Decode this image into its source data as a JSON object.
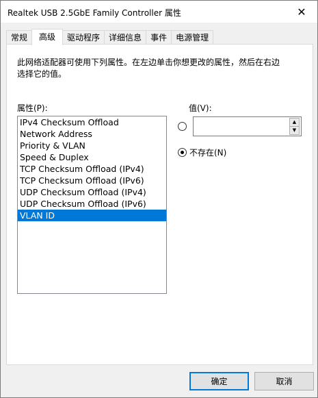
{
  "window": {
    "title": "Realtek USB 2.5GbE Family Controller 属性",
    "close_glyph": "✕"
  },
  "tabs": [
    {
      "label": "常规"
    },
    {
      "label": "高级"
    },
    {
      "label": "驱动程序"
    },
    {
      "label": "详细信息"
    },
    {
      "label": "事件"
    },
    {
      "label": "电源管理"
    }
  ],
  "active_tab": "高级",
  "panel": {
    "description": "此网络适配器可使用下列属性。在左边单击你想更改的属性，然后在右边选择它的值。",
    "property_label": "属性(P):",
    "value_label": "值(V):",
    "absent_label": "不存在(N)",
    "value_input": ""
  },
  "properties": [
    "IPv4 Checksum Offload",
    "Network Address",
    "Priority & VLAN",
    "Speed & Duplex",
    "TCP Checksum Offload (IPv4)",
    "TCP Checksum Offload (IPv6)",
    "UDP Checksum Offload (IPv4)",
    "UDP Checksum Offload (IPv6)",
    "VLAN ID"
  ],
  "selected_property": "VLAN ID",
  "spin": {
    "up": "▲",
    "down": "▼"
  },
  "buttons": {
    "ok": "确定",
    "cancel": "取消"
  },
  "colors": {
    "selection": "#0078d7",
    "default_button_border": "#0078d7"
  }
}
